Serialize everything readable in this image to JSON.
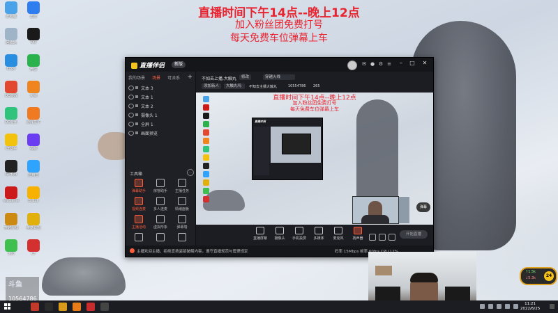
{
  "overlay": {
    "line1": "直播时间下午14点--晚上12点",
    "line2": "加入粉丝团免费打号",
    "line3": "每天免费车位弹幕上车"
  },
  "desktop": {
    "icons": [
      {
        "label": "此电脑",
        "color": "#4aa3e8"
      },
      {
        "label": "迅雷",
        "color": "#2e7ef0"
      },
      {
        "label": "回收站",
        "color": "#a0b4c8"
      },
      {
        "label": "QQ",
        "color": "#1a1a1a"
      },
      {
        "label": "Edge",
        "color": "#2a8ee0"
      },
      {
        "label": "微信",
        "color": "#2bb24c"
      },
      {
        "label": "QQ游戏",
        "color": "#e2472f"
      },
      {
        "label": "火绒",
        "color": "#f0851f"
      },
      {
        "label": "QQ音乐",
        "color": "#31c27c"
      },
      {
        "label": "游戏盒子",
        "color": "#f07a22"
      },
      {
        "label": "CF助手",
        "color": "#f3c20d"
      },
      {
        "label": "视频",
        "color": "#6b3df2"
      },
      {
        "label": "G-HUB",
        "color": "#222222"
      },
      {
        "label": "应用宝",
        "color": "#2fa4ff"
      },
      {
        "label": "WeGame",
        "color": "#cc1a1a"
      },
      {
        "label": "Bilibili",
        "color": "#f7b100"
      },
      {
        "label": "穿越火线",
        "color": "#cc8a12"
      },
      {
        "label": "英雄联盟",
        "color": "#e1b00a"
      },
      {
        "label": "360",
        "color": "#3fbf4f"
      },
      {
        "label": "CF",
        "color": "#d3302f"
      }
    ],
    "streamer_logo": "斗鱼",
    "streamer_id": "10564786"
  },
  "app": {
    "brand": "直播伴侣",
    "version": "新版",
    "left_tabs": [
      "我的场景",
      "场景",
      "可派系"
    ],
    "sources": [
      "文本 3",
      "文本 1",
      "文本 2",
      "摄像头 1",
      "全屏 1",
      "画面预览"
    ],
    "tools_title": "工具箱",
    "tools": [
      {
        "label": "弹幕助手",
        "red": true
      },
      {
        "label": "房管助手",
        "red": false
      },
      {
        "label": "主播任务",
        "red": false
      },
      {
        "label": "视频连麦",
        "red": true
      },
      {
        "label": "多人连麦",
        "red": false
      },
      {
        "label": "情绪面板",
        "red": false
      },
      {
        "label": "主播活动",
        "red": true
      },
      {
        "label": "虚拟形象",
        "red": false
      },
      {
        "label": "弹幕墙",
        "red": false
      },
      {
        "label": "",
        "red": false
      },
      {
        "label": "",
        "red": false
      },
      {
        "label": "",
        "red": false
      }
    ],
    "header": {
      "title": "不如去上播,大触丸",
      "edit_chip": "修改",
      "category_chip": "穿越火线",
      "row2_left": "添加新人",
      "row2_mid": "大触丸吗",
      "row2_right": "不知去主播大触丸",
      "room_id": "10554786",
      "heat": "265"
    },
    "controls": [
      {
        "label": "直播屏幕",
        "red": false
      },
      {
        "label": "摄像头",
        "red": false
      },
      {
        "label": "手机投屏",
        "red": false
      },
      {
        "label": "多媒体",
        "red": false
      },
      {
        "label": "麦克风",
        "red": false
      },
      {
        "label": "扬声器",
        "red": true
      }
    ],
    "go_live": "开始直播",
    "status_text": "主播欢迎主播，拒绝宣扬盗版破解内容，遵守直播规范与管理规定",
    "status_right": "码率 15Mbps  帧率 60fps  CPU 12%"
  },
  "preview": {
    "caption1": "直播时间下午14点--晚上12点",
    "caption2": "加入粉丝团免费打号",
    "caption3": "每天免费车位弹幕上车",
    "badge": "弹幕"
  },
  "network": {
    "up": "↑1.5k",
    "down": "↓5.3k",
    "pct": "24"
  },
  "taskbar": {
    "time": "11:21",
    "date": "2022/6/25",
    "apps_colors": [
      "#c23a2a",
      "#2b2b2b",
      "#d89a1b",
      "#e87c1b",
      "#c72d2d",
      "#444444"
    ]
  }
}
